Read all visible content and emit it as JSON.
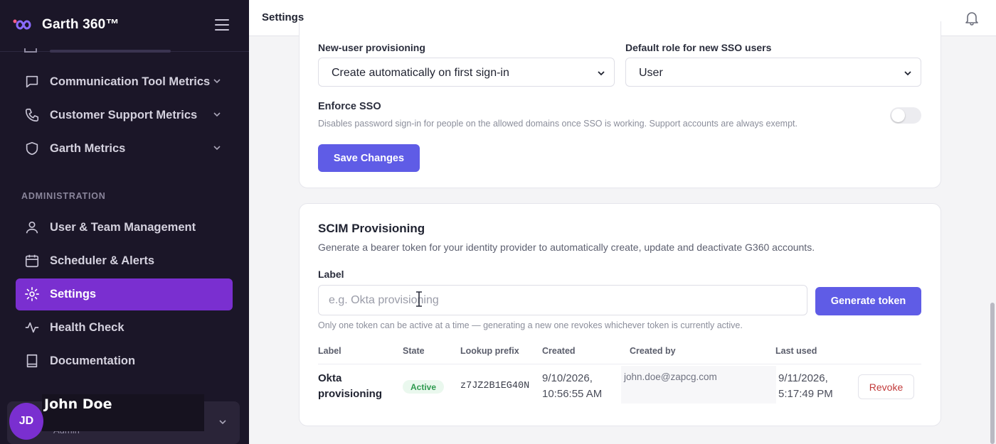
{
  "app": {
    "name": "Garth 360™"
  },
  "sidebar": {
    "items": [
      {
        "label": "Communication Tool Metrics"
      },
      {
        "label": "Customer Support Metrics"
      },
      {
        "label": "Garth Metrics"
      }
    ],
    "section_title": "ADMINISTRATION",
    "admin_items": [
      {
        "label": "User & Team Management"
      },
      {
        "label": "Scheduler & Alerts"
      },
      {
        "label": "Settings"
      },
      {
        "label": "Health Check"
      },
      {
        "label": "Documentation"
      }
    ],
    "user": {
      "initials": "JD",
      "name": "John Doe",
      "role": "Admin"
    }
  },
  "topbar": {
    "title": "Settings"
  },
  "sso": {
    "provisioning_label": "New-user provisioning",
    "provisioning_value": "Create automatically on first sign-in",
    "role_label": "Default role for new SSO users",
    "role_value": "User",
    "enforce_title": "Enforce SSO",
    "enforce_desc": "Disables password sign-in for people on the allowed domains once SSO is working. Support accounts are always exempt.",
    "enforce_enabled": false,
    "save_label": "Save Changes"
  },
  "scim": {
    "title": "SCIM Provisioning",
    "subtitle": "Generate a bearer token for your identity provider to automatically create, update and deactivate G360 accounts.",
    "label_field": "Label",
    "label_placeholder": "e.g. Okta provisioning",
    "generate_label": "Generate token",
    "note": "Only one token can be active at a time — generating a new one revokes whichever token is currently active.",
    "table": {
      "headers": [
        "Label",
        "State",
        "Lookup prefix",
        "Created",
        "Created by",
        "Last used"
      ],
      "rows": [
        {
          "label": "Okta provisioning",
          "state": "Active",
          "prefix": "z7JZ2B1EG40N",
          "created": "9/10/2026, 10:56:55 AM",
          "created_by": "john.doe@zapcg.com",
          "last_used": "9/11/2026, 5:17:49 PM",
          "action": "Revoke"
        }
      ]
    }
  },
  "colors": {
    "accent": "#5f5ce6",
    "sidebar_bg": "#1b1628",
    "active_nav": "#7a2fd0",
    "status_active": "#2f9a4f",
    "danger": "#c23a3a"
  }
}
